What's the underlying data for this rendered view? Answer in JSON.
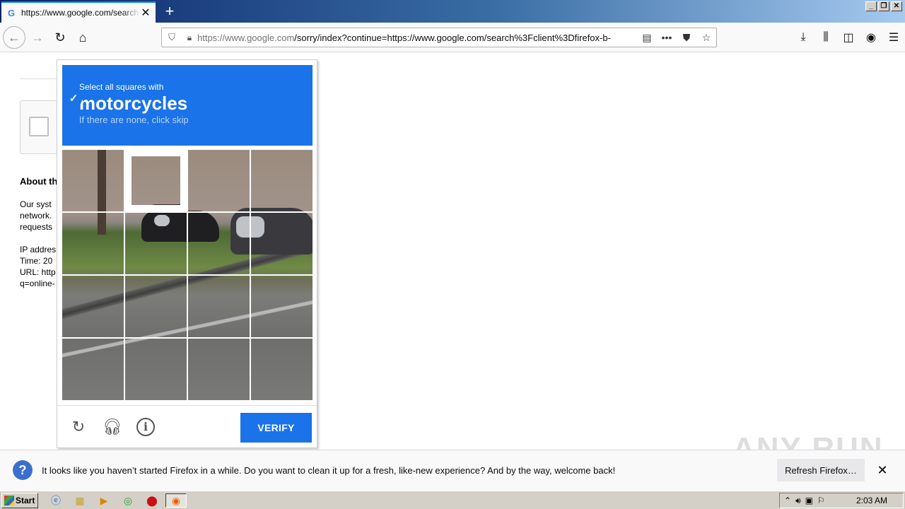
{
  "browser": {
    "tab_title": "https://www.google.com/search?c",
    "tab_favicon": "G",
    "url_host": "https://www.google.com",
    "url_rest": "/sorry/index?continue=https://www.google.com/search%3Fclient%3Dfirefox-b-",
    "accent": "#0a84ff"
  },
  "page": {
    "about_title": "About th",
    "about_lines": [
      "Our syst",
      "network.",
      "requests",
      "",
      "IP addres",
      "Time: 20",
      "URL: http",
      "q=online-"
    ]
  },
  "captcha": {
    "instruction": "Select all squares with",
    "target": "motorcycles",
    "hint": "If there are none, click skip",
    "verify_label": "VERIFY",
    "selected_tiles": [
      1
    ],
    "header_color": "#1a73e8"
  },
  "notification": {
    "message": "It looks like you haven’t started Firefox in a while. Do you want to clean it up for a fresh, like-new experience? And by the way, welcome back!",
    "button": "Refresh Firefox…"
  },
  "watermark": "ANY RUN",
  "taskbar": {
    "start_label": "Start",
    "clock": "2:03 AM"
  }
}
